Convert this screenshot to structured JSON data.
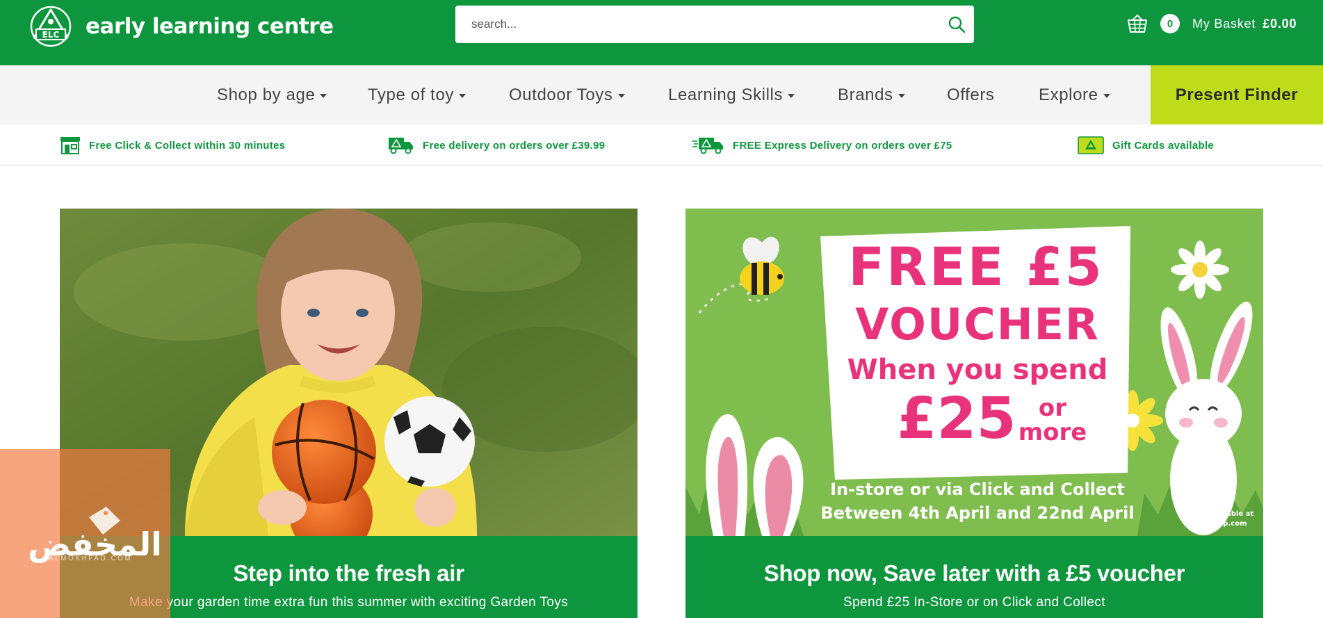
{
  "header": {
    "logo_badge": "ELC",
    "brand_name": "early learning centre",
    "search_placeholder": "search...",
    "basket": {
      "count": "0",
      "label": "My Basket",
      "total": "£0.00"
    }
  },
  "nav": {
    "items": [
      {
        "label": "Shop by age",
        "has_dropdown": true
      },
      {
        "label": "Type of toy",
        "has_dropdown": true
      },
      {
        "label": "Outdoor Toys",
        "has_dropdown": true
      },
      {
        "label": "Learning Skills",
        "has_dropdown": true
      },
      {
        "label": "Brands",
        "has_dropdown": true
      },
      {
        "label": "Offers",
        "has_dropdown": false
      },
      {
        "label": "Explore",
        "has_dropdown": true
      }
    ],
    "cta_label": "Present Finder"
  },
  "usp_bar": [
    {
      "icon": "store-icon",
      "text": "Free Click & Collect within 30 minutes"
    },
    {
      "icon": "delivery-van-icon",
      "text": "Free delivery on orders over £39.99"
    },
    {
      "icon": "express-delivery-van-icon",
      "text": "FREE Express Delivery on orders over £75"
    },
    {
      "icon": "gift-card-icon",
      "text": "Gift Cards available"
    }
  ],
  "promos": [
    {
      "image": "child-holding-balls-photo",
      "title": "Step into the fresh air",
      "subtitle": "Make your garden time extra fun this summer with exciting Garden Toys"
    },
    {
      "image": "free-voucher-easter-banner",
      "banner": {
        "line1": "FREE £5",
        "line2": "VOUCHER",
        "line3": "When you spend",
        "amount": "£25",
        "or": "or",
        "more": "more",
        "line5": "In-store or via Click and Collect",
        "line6": "Between 4th April and 22nd April",
        "tcs1": "T&Cs available at",
        "tcs2": "thetoyshop.com"
      },
      "title": "Shop now, Save later with a £5 voucher",
      "subtitle": "Spend £25 In-Store or on Click and Collect"
    }
  ],
  "watermark": {
    "text": "المخفض",
    "sub": "ALMOKHFAD.COM"
  },
  "colors": {
    "brand_green": "#0e963e",
    "nav_background": "#f4f4f4",
    "present_finder_lime": "#bedc1a",
    "voucher_pink": "#e8337a",
    "voucher_green": "#7fbd4f"
  }
}
